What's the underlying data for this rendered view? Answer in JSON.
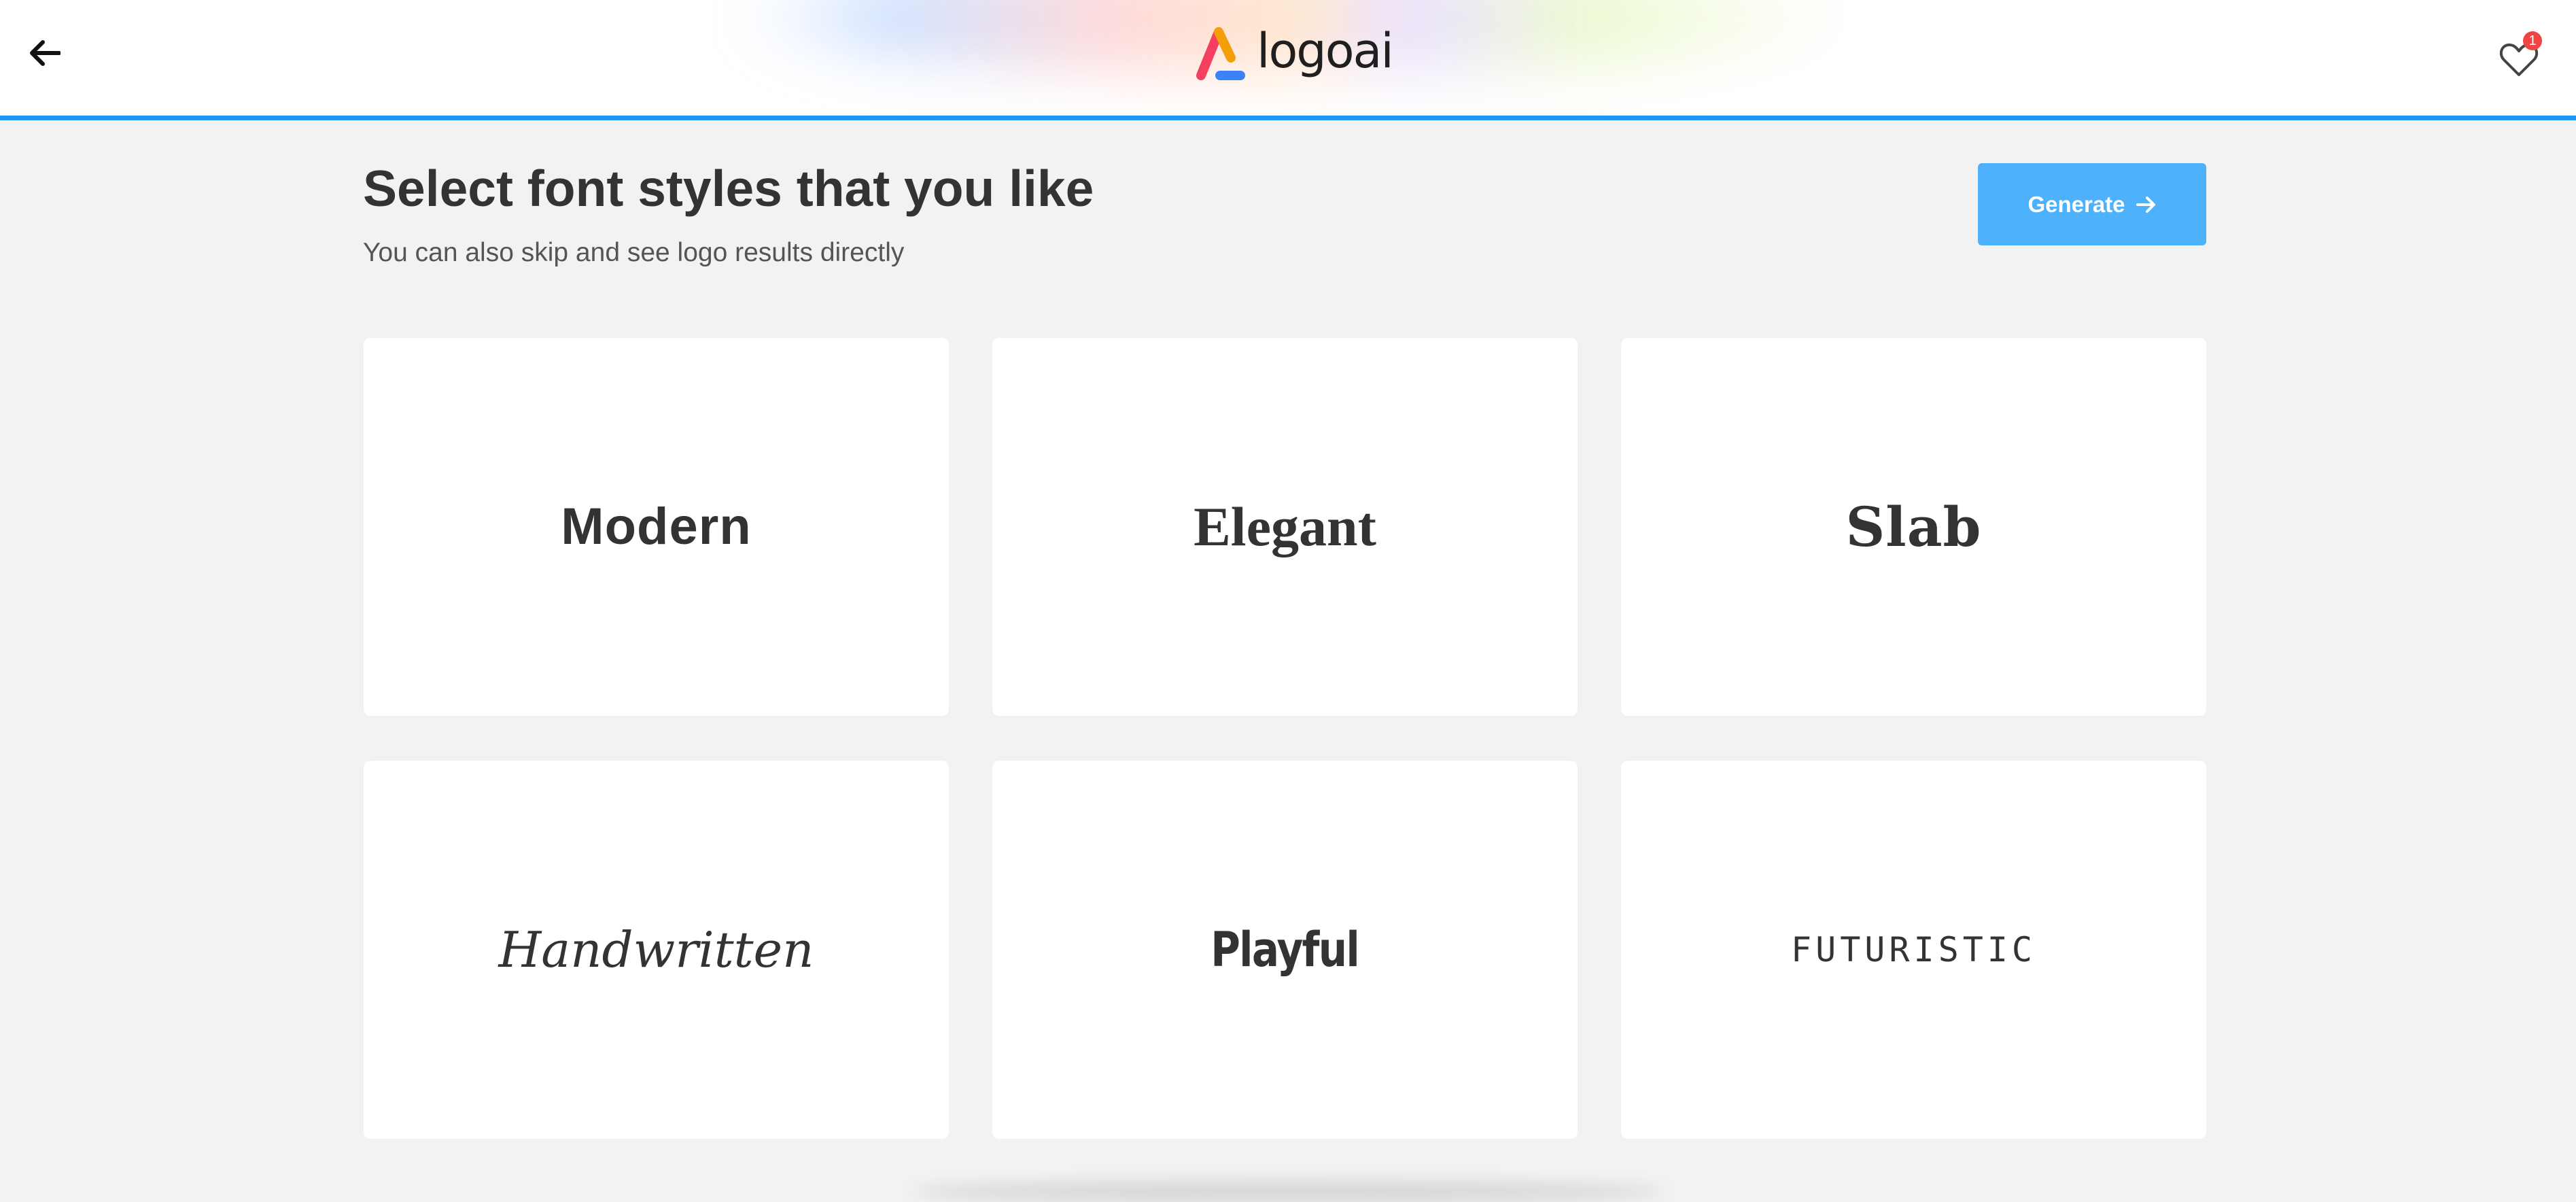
{
  "header": {
    "back_icon": "arrow-left-icon",
    "logo_text": "logoai",
    "favorites_icon": "heart-outline-icon",
    "favorites_count": "1",
    "accent_color": "#2196f3"
  },
  "main": {
    "title": "Select font styles that you like",
    "subtitle": "You can also skip and see logo results directly",
    "generate_label": "Generate",
    "generate_icon": "arrow-right-icon",
    "generate_color": "#4db1fb"
  },
  "font_styles": [
    {
      "label": "Modern"
    },
    {
      "label": "Elegant"
    },
    {
      "label": "Slab"
    },
    {
      "label": "Handwritten"
    },
    {
      "label": "Playful"
    },
    {
      "label": "FUTURISTIC"
    }
  ]
}
